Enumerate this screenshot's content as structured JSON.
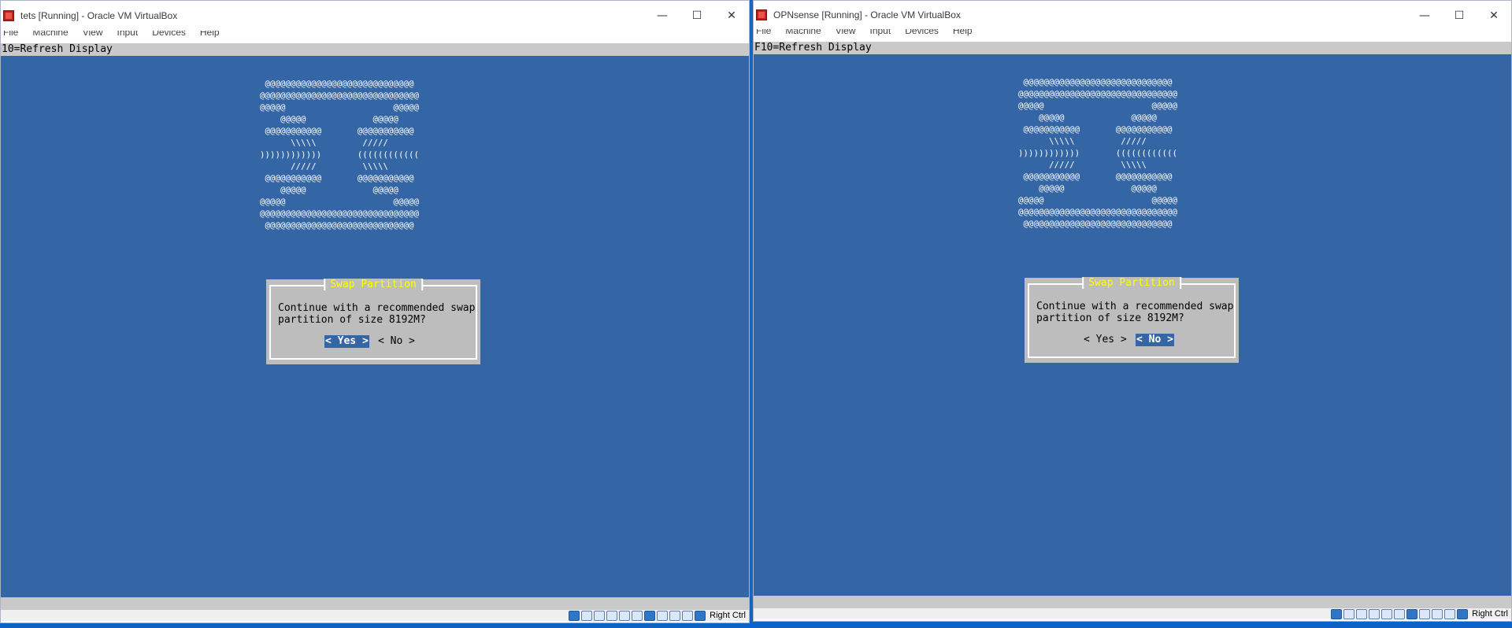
{
  "windows": [
    {
      "title": "tets [Running] - Oracle VM VirtualBox",
      "menu": [
        "File",
        "Machine",
        "View",
        "Input",
        "Devices",
        "Help"
      ],
      "statusline": "10=Refresh Display",
      "dialog": {
        "title": "Swap Partition",
        "message": "Continue with a recommended swap\npartition of size 8192M?",
        "yes_label": "< Yes >",
        "no_label": "< No >",
        "selected": "yes"
      },
      "host_key": "Right Ctrl"
    },
    {
      "title": "OPNsense [Running] - Oracle VM VirtualBox",
      "menu": [
        "File",
        "Machine",
        "View",
        "Input",
        "Devices",
        "Help"
      ],
      "statusline": "F10=Refresh Display",
      "dialog": {
        "title": "Swap Partition",
        "message": "Continue with a recommended swap\npartition of size 8192M?",
        "yes_label": "< Yes >",
        "no_label": "< No >",
        "selected": "no"
      },
      "host_key": "Right Ctrl"
    }
  ],
  "ascii_logo": " @@@@@@@@@@@@@@@@@@@@@@@@@@@@@\n@@@@@@@@@@@@@@@@@@@@@@@@@@@@@@@\n@@@@@                     @@@@@\n    @@@@@             @@@@@\n @@@@@@@@@@@       @@@@@@@@@@@\n      \\\\\\\\\\         /////\n))))))))))))       ((((((((((((\n      /////         \\\\\\\\\\\n @@@@@@@@@@@       @@@@@@@@@@@\n    @@@@@             @@@@@\n@@@@@                     @@@@@\n@@@@@@@@@@@@@@@@@@@@@@@@@@@@@@@\n @@@@@@@@@@@@@@@@@@@@@@@@@@@@@",
  "window_controls": [
    "—",
    "☐",
    "✕"
  ],
  "icons": [
    "vbox-logo-icon",
    "minimize-icon",
    "maximize-icon",
    "close-icon",
    "hdd-icon",
    "optical-icon",
    "audio-icon",
    "network-icon",
    "usb-icon",
    "shared-folder-icon",
    "display-icon",
    "recording-icon",
    "cpu-icon",
    "mouse-icon",
    "host-key-icon"
  ]
}
